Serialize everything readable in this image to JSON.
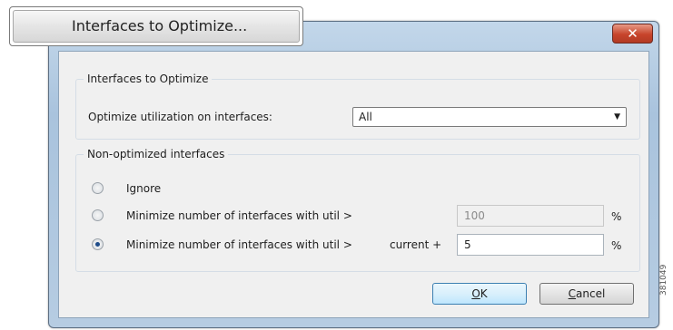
{
  "callout": {
    "label": "Interfaces to Optimize..."
  },
  "titlebar": {
    "close_glyph": "✕"
  },
  "group_optimize": {
    "legend": "Interfaces to Optimize",
    "label": "Optimize utilization on interfaces:",
    "select_value": "All"
  },
  "group_nonopt": {
    "legend": "Non-optimized interfaces",
    "options": [
      {
        "label": "Ignore",
        "selected": false
      },
      {
        "label": "Minimize number of interfaces with util >",
        "value": "100",
        "unit": "%",
        "selected": false
      },
      {
        "label": "Minimize number of interfaces with util >",
        "extra": "current +",
        "value": "5",
        "unit": "%",
        "selected": true
      }
    ]
  },
  "buttons": {
    "ok_mnemonic": "O",
    "ok_rest": "K",
    "cancel_mnemonic": "C",
    "cancel_rest": "ancel"
  },
  "figure_id": "381049"
}
